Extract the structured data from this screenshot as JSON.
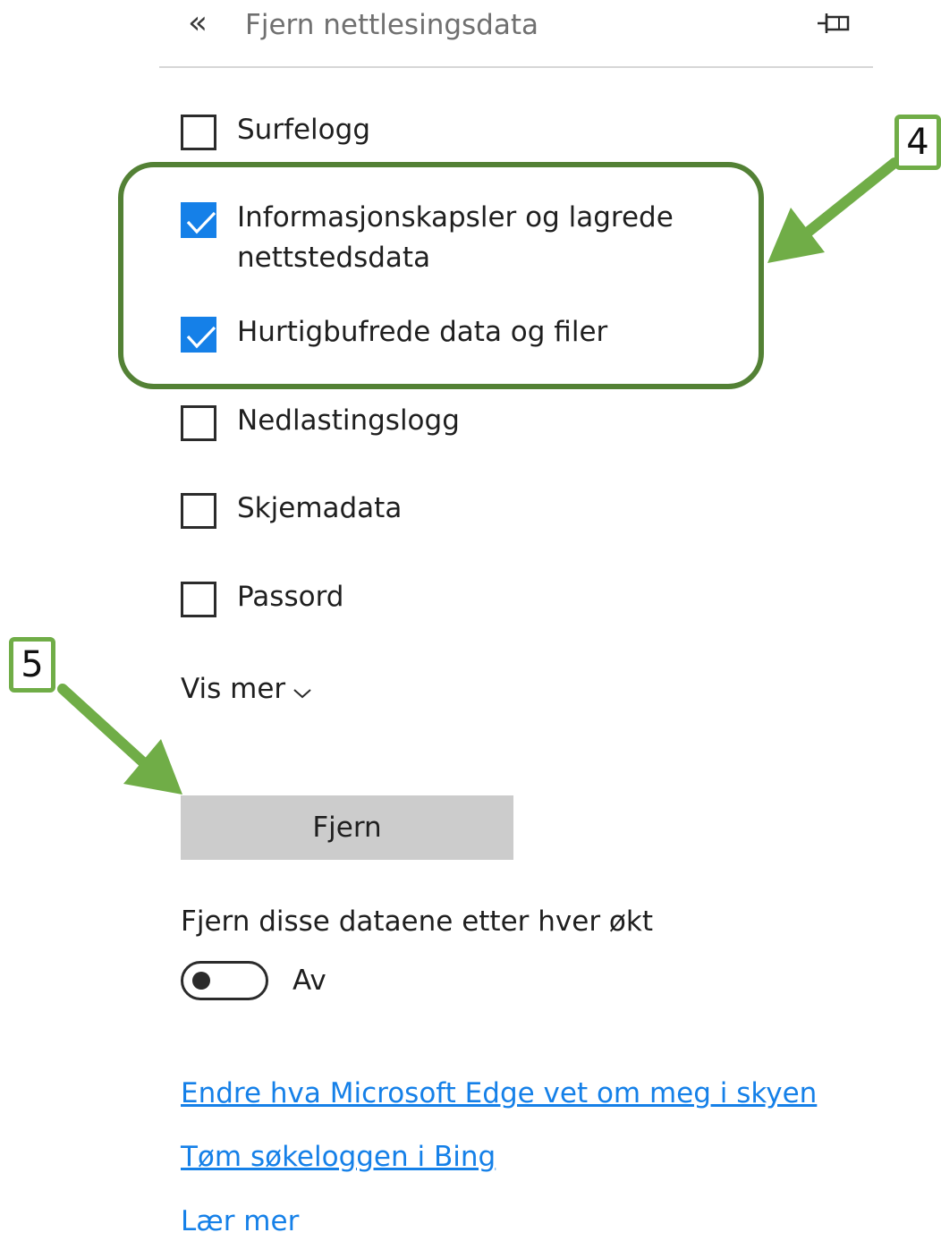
{
  "header": {
    "back_icon": "double-chevron-left-icon",
    "title": "Fjern nettlesingsdata",
    "pin_icon": "pin-icon"
  },
  "options": [
    {
      "label": "Surfelogg",
      "checked": false
    },
    {
      "label": "Informasjonskapsler og lagrede nettstedsdata",
      "checked": true
    },
    {
      "label": "Hurtigbufrede data og filer",
      "checked": true
    },
    {
      "label": "Nedlastingslogg",
      "checked": false
    },
    {
      "label": "Skjemadata",
      "checked": false
    },
    {
      "label": "Passord",
      "checked": false
    }
  ],
  "show_more": {
    "label": "Vis mer",
    "icon": "chevron-down-icon"
  },
  "clear_button": {
    "label": "Fjern"
  },
  "session": {
    "label": "Fjern disse dataene etter hver økt",
    "toggle_state": "Av",
    "toggle_on": false
  },
  "links": [
    "Endre hva Microsoft Edge vet om meg i skyen",
    "Tøm søkeloggen i Bing",
    "Lær mer"
  ],
  "annotations": {
    "step_4": "4",
    "step_5": "5",
    "highlight_color": "#538135",
    "arrow_color": "#70ad47"
  },
  "colors": {
    "accent": "#1580e8",
    "button_bg": "#cccccc"
  }
}
